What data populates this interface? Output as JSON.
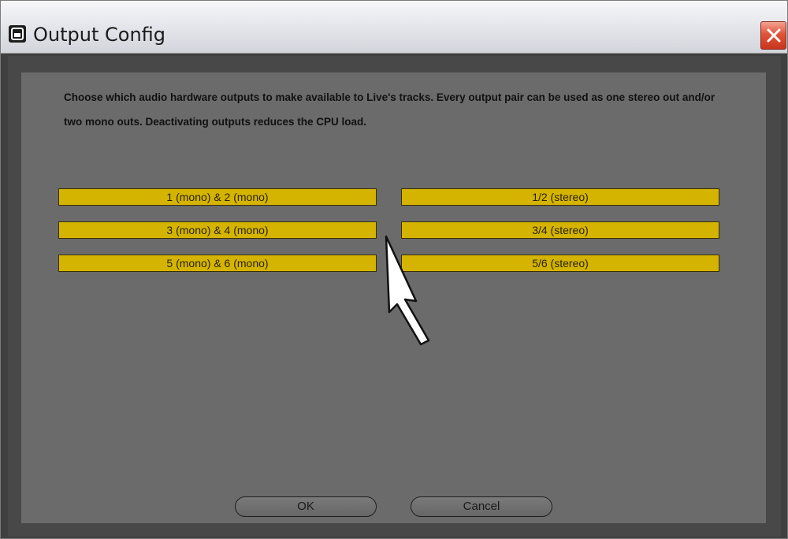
{
  "window": {
    "title": "Output Config",
    "app_icon": "ableton-live-icon",
    "close_icon": "close-icon"
  },
  "description": "Choose which audio hardware outputs to make available to Live's tracks. Every output pair can be used as one stereo out and/or two mono outs.  Deactivating outputs reduces the CPU load.",
  "outputs": {
    "mono": [
      {
        "label": "1 (mono) & 2 (mono)",
        "active": true
      },
      {
        "label": "3 (mono) & 4 (mono)",
        "active": true
      },
      {
        "label": "5 (mono) & 6 (mono)",
        "active": true
      }
    ],
    "stereo": [
      {
        "label": "1/2 (stereo)",
        "active": true
      },
      {
        "label": "3/4 (stereo)",
        "active": true
      },
      {
        "label": "5/6 (stereo)",
        "active": true
      }
    ]
  },
  "buttons": {
    "ok": "OK",
    "cancel": "Cancel"
  },
  "colors": {
    "active_output": "#d4b400",
    "panel": "#6b6b6b",
    "frame": "#484848"
  }
}
